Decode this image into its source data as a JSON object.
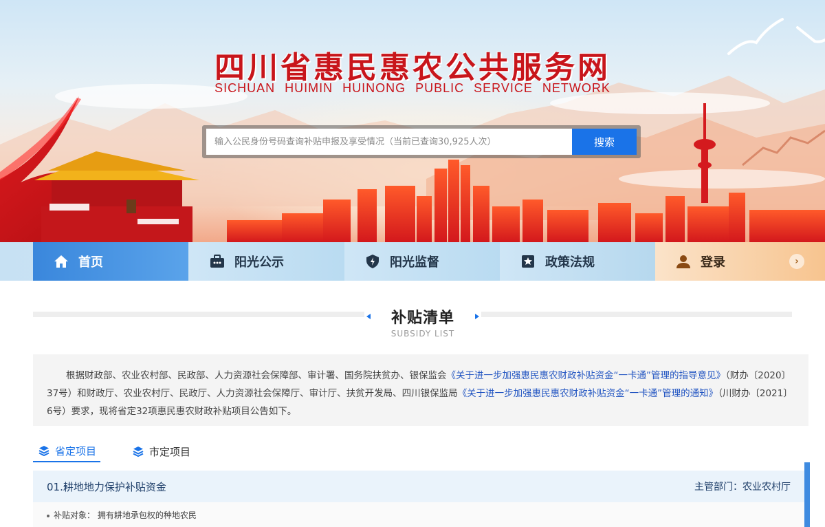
{
  "header": {
    "title": "四川省惠民惠农公共服务网",
    "subtitle": "SICHUAN HUIMIN HUINONG PUBLIC SERVICE NETWORK",
    "search_placeholder": "输入公民身份号码查询补贴申报及享受情况（当前已查询30,925人次）",
    "search_button": "搜索"
  },
  "nav": {
    "items": [
      {
        "label": "首页",
        "icon": "home-icon"
      },
      {
        "label": "阳光公示",
        "icon": "briefcase-icon"
      },
      {
        "label": "阳光监督",
        "icon": "shield-icon"
      },
      {
        "label": "政策法规",
        "icon": "star-box-icon"
      },
      {
        "label": "登录",
        "icon": "user-icon"
      }
    ]
  },
  "section": {
    "title": "补贴清单",
    "subtitle": "SUBSIDY LIST"
  },
  "intro": {
    "part1": "根据财政部、农业农村部、民政部、人力资源社会保障部、审计署、国务院扶贫办、银保监会",
    "link1": "《关于进一步加强惠民惠农财政补贴资金“一卡通”管理的指导意见》",
    "part2": "（财办〔2020〕37号）和财政厅、农业农村厅、民政厅、人力资源社会保障厅、审计厅、扶贫开发局、四川银保监局",
    "link2": "《关于进一步加强惠民惠农财政补贴资金“一卡通”管理的通知》",
    "part3": "（川财办〔2021〕6号）要求，现将省定32项惠民惠农财政补贴项目公告如下。"
  },
  "tabs": [
    {
      "label": "省定项目",
      "active": true
    },
    {
      "label": "市定项目",
      "active": false
    }
  ],
  "project": {
    "name": "01.耕地地力保护补贴资金",
    "dept": "主管部门：农业农村厅",
    "target": "补贴对象： 拥有耕地承包权的种地农民"
  },
  "colors": {
    "brand_red": "#c8151b",
    "accent_blue": "#1a73e8",
    "login_orange": "#f7c48f"
  }
}
